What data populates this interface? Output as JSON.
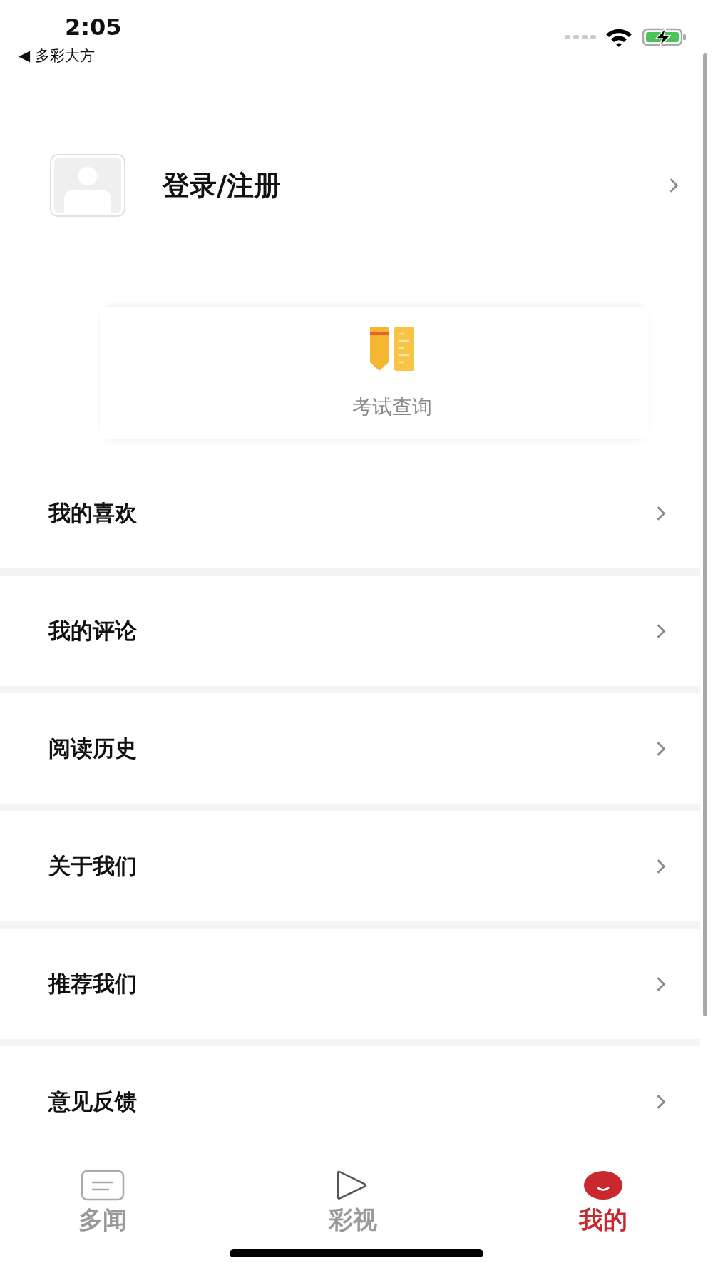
{
  "status_bar": {
    "time": "2:05",
    "back_label": "◀ 多彩大方"
  },
  "profile": {
    "label": "登录/注册"
  },
  "services": [
    {
      "label": "考试查询"
    }
  ],
  "menu": [
    {
      "label": "我的喜欢"
    },
    {
      "label": "我的评论"
    },
    {
      "label": "阅读历史"
    },
    {
      "label": "关于我们"
    },
    {
      "label": "推荐我们"
    },
    {
      "label": "意见反馈"
    }
  ],
  "tabs": [
    {
      "label": "多闻",
      "kind": "news",
      "selected": false
    },
    {
      "label": "彩视",
      "kind": "video",
      "selected": false
    },
    {
      "label": "我的",
      "kind": "me",
      "selected": true
    }
  ]
}
